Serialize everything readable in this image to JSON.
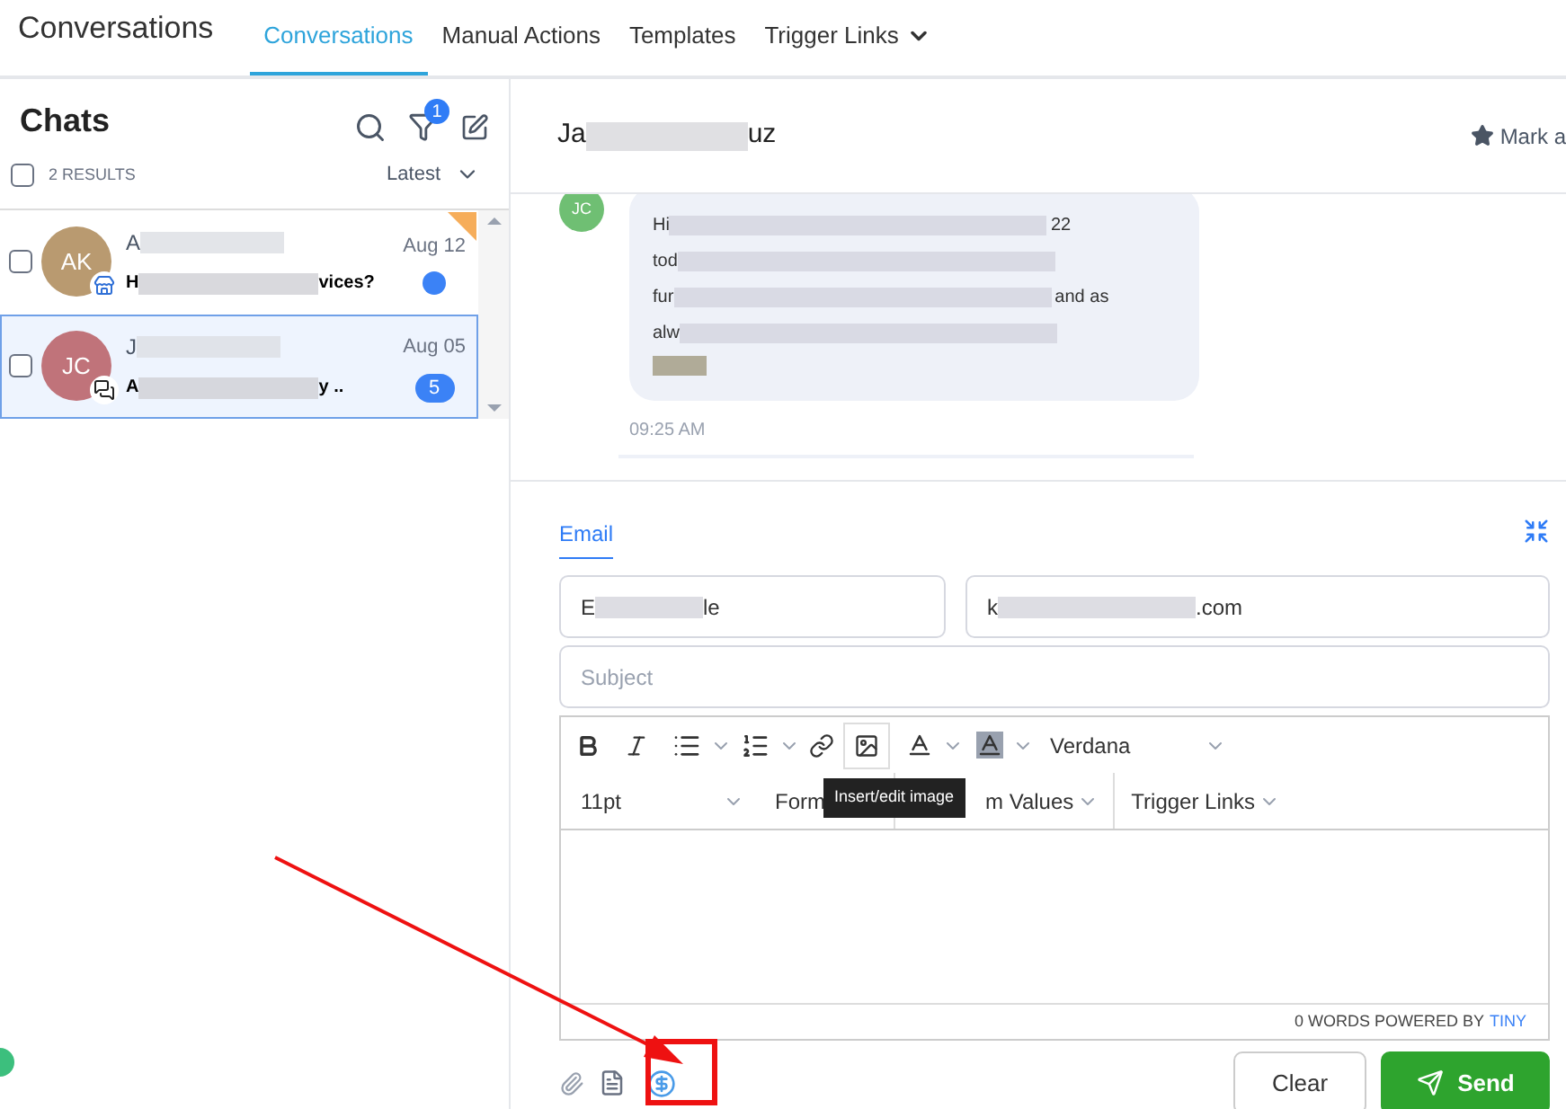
{
  "header": {
    "title": "Conversations",
    "tabs": [
      {
        "label": "Conversations",
        "selected": true,
        "has_caret": false
      },
      {
        "label": "Manual Actions",
        "selected": false,
        "has_caret": false
      },
      {
        "label": "Templates",
        "selected": false,
        "has_caret": false
      },
      {
        "label": "Trigger Links",
        "selected": false,
        "has_caret": true
      }
    ]
  },
  "chats": {
    "title": "Chats",
    "filter_count": "1",
    "select_all_checked": false,
    "results": "2 RESULTS",
    "sort": "Latest",
    "items": [
      {
        "initials": "AK",
        "color": "#b99a70",
        "kind": "business",
        "name_start": "A",
        "preview_start": "H",
        "preview_end": "vices?",
        "date": "Aug 12",
        "starred": true,
        "selected": false,
        "unread": true
      },
      {
        "initials": "JC",
        "color": "#c0737a",
        "kind": "chat",
        "name_start": "J",
        "preview_start": "A",
        "preview_end": "y ..",
        "date": "Aug 05",
        "starred": false,
        "selected": true,
        "unread": true,
        "count": "5"
      }
    ]
  },
  "conversation": {
    "name_start": "Ja",
    "name_end": "uz",
    "mark_label": "Mark a",
    "message": {
      "initials": "JC",
      "lines": [
        {
          "start": "Hi",
          "end": "22"
        },
        {
          "start": "tod"
        },
        {
          "start": "fur",
          "end": "and as"
        },
        {
          "start": "alw"
        }
      ],
      "time": "09:25 AM"
    }
  },
  "composer": {
    "tab": "Email",
    "from_start": "E",
    "from_end": "le",
    "to_start": "k",
    "to_end": ".com",
    "subject_placeholder": "Subject",
    "font": "Verdana",
    "size": "11pt",
    "menus": [
      {
        "label": "Form"
      },
      {
        "label": "m Values",
        "has_caret": true
      },
      {
        "label": "Trigger Links",
        "has_caret": true
      }
    ],
    "tooltip": "Insert/edit image",
    "word_count": "0 WORDS POWERED BY",
    "brand": "TINY",
    "clear": "Clear",
    "send": "Send"
  }
}
